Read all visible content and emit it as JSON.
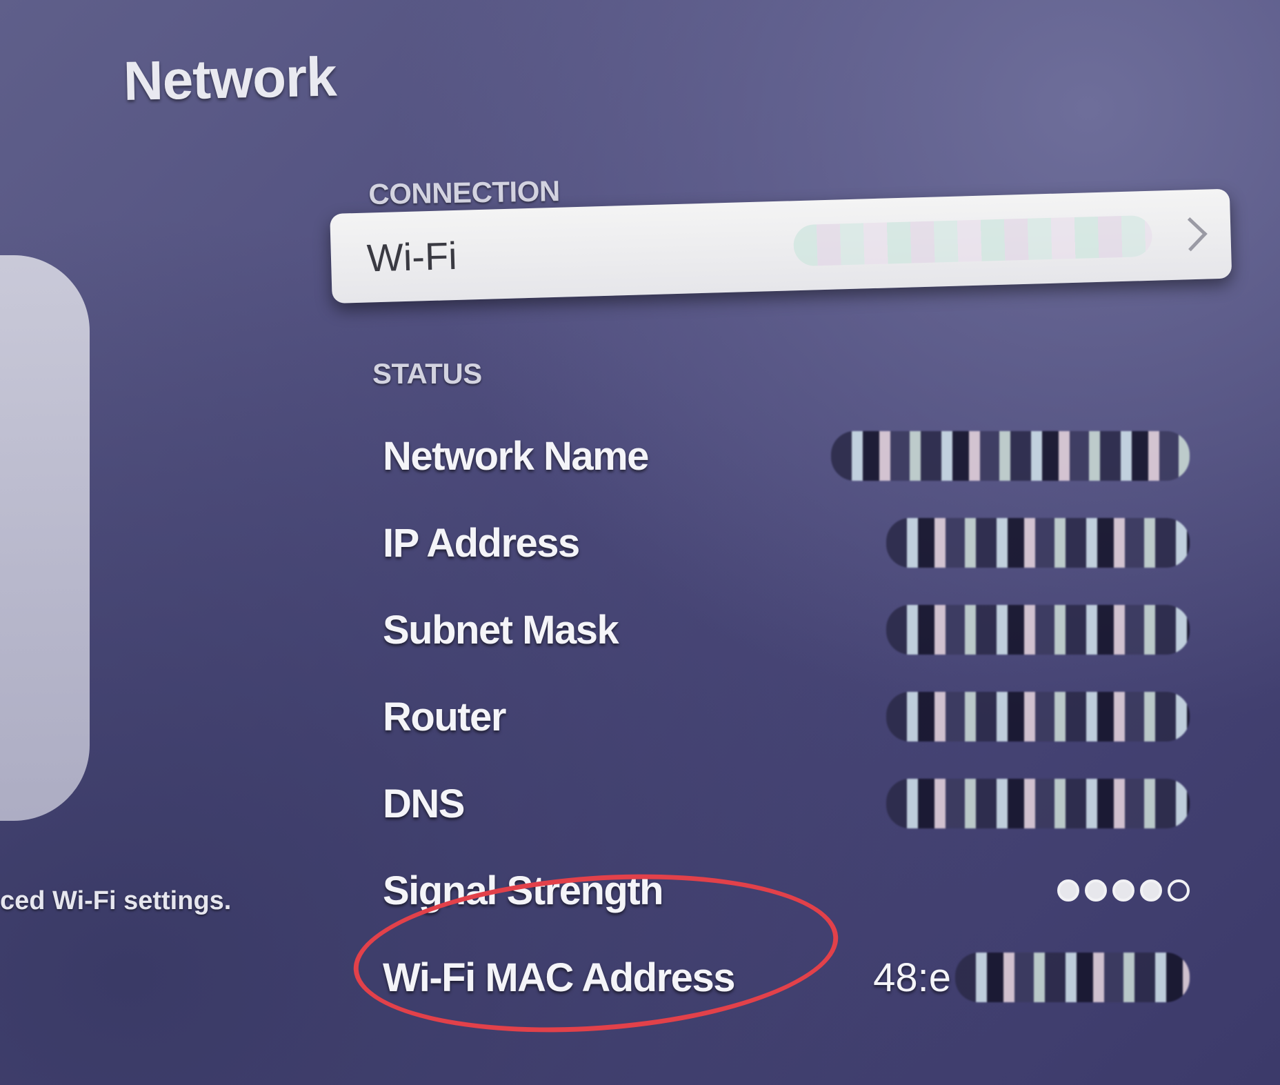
{
  "page": {
    "title": "Network"
  },
  "sidebar": {
    "caption": "ced Wi-Fi settings."
  },
  "connection": {
    "header": "CONNECTION",
    "row": {
      "label": "Wi-Fi",
      "value_visible": "",
      "chevron_icon": "chevron-right-icon"
    }
  },
  "status": {
    "header": "STATUS",
    "rows": [
      {
        "label": "Network Name",
        "value": ""
      },
      {
        "label": "IP Address",
        "value": ""
      },
      {
        "label": "Subnet Mask",
        "value": ""
      },
      {
        "label": "Router",
        "value": ""
      },
      {
        "label": "DNS",
        "value": ""
      },
      {
        "label": "Signal Strength",
        "signal_level": 0.8
      },
      {
        "label": "Wi-Fi MAC Address",
        "value_visible": "48:e"
      }
    ]
  },
  "annotation": {
    "color": "#e2414a",
    "target": "Wi-Fi MAC Address"
  },
  "colors": {
    "background": "#4d4b7c",
    "row_focus": "#f4f4f4",
    "text": "#f4f4f8"
  }
}
